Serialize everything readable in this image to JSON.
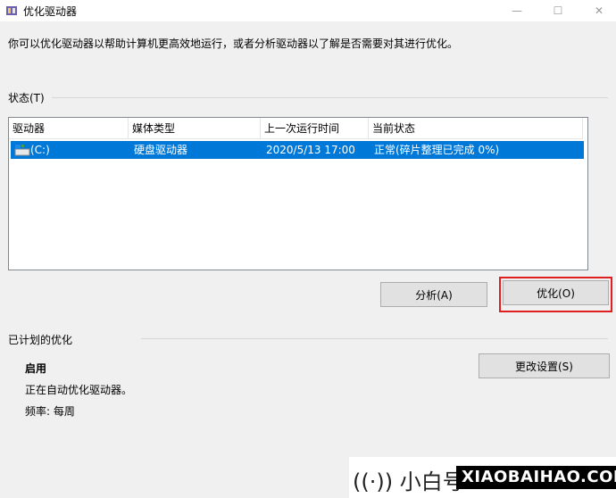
{
  "window": {
    "title": "优化驱动器",
    "controls": {
      "minimize": "—",
      "maximize": "☐",
      "close": "✕"
    }
  },
  "description": "你可以优化驱动器以帮助计算机更高效地运行，或者分析驱动器以了解是否需要对其进行优化。",
  "status_section": {
    "label": "状态(T)",
    "columns": [
      "驱动器",
      "媒体类型",
      "上一次运行时间",
      "当前状态"
    ],
    "rows": [
      {
        "drive": "(C:)",
        "media": "硬盘驱动器",
        "last_run": "2020/5/13 17:00",
        "status": "正常(碎片整理已完成 0%)"
      }
    ]
  },
  "buttons": {
    "analyze": "分析(A)",
    "optimize": "优化(O)",
    "change_settings": "更改设置(S)"
  },
  "scheduled": {
    "label": "已计划的优化",
    "state": "启用",
    "detail": "正在自动优化驱动器。",
    "frequency": "频率: 每周"
  },
  "watermark": {
    "logo": "((·)) 小白号",
    "brand": "XIAOBAIHAO.COM"
  },
  "colors": {
    "selection": "#0078d7",
    "highlight_border": "#e02020"
  }
}
